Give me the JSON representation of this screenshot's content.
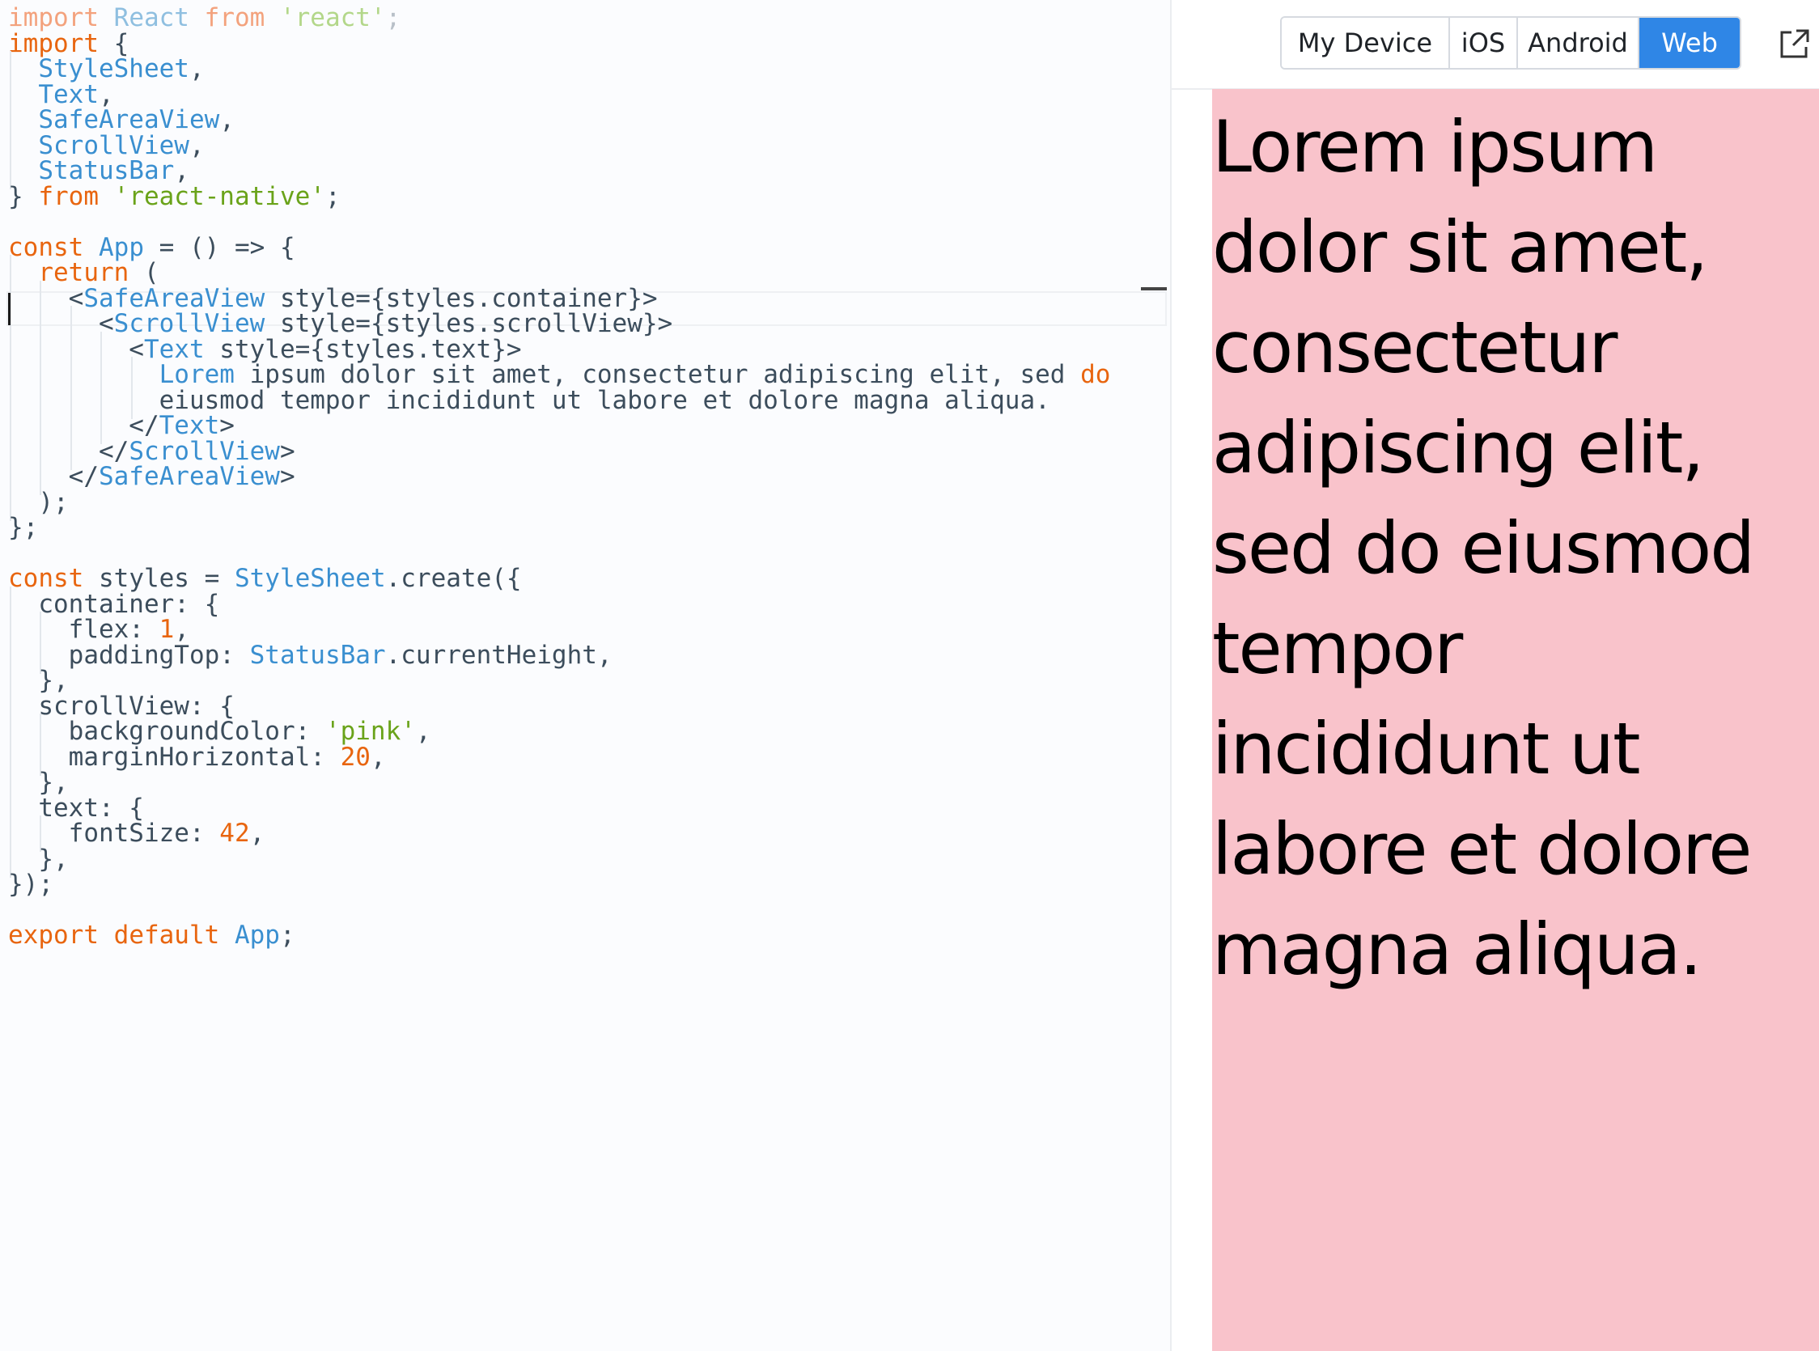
{
  "code_lines": [
    [
      [
        "import",
        "#f3a27d"
      ],
      [
        " ",
        "#3c4d5c"
      ],
      [
        "React",
        "#8fbfe0"
      ],
      [
        " ",
        "#3c4d5c"
      ],
      [
        "from",
        "#f3a27d"
      ],
      [
        " ",
        "#3c4d5c"
      ],
      [
        "'react'",
        "#b3d78a"
      ],
      [
        ";",
        "#b8c0c8"
      ]
    ],
    [
      [
        "import",
        "#e8650f"
      ],
      [
        " {",
        "#3c4d5c"
      ]
    ],
    [
      [
        "  ",
        "#3c4d5c"
      ],
      [
        "StyleSheet",
        "#3a8fd0"
      ],
      [
        ",",
        "#3c4d5c"
      ]
    ],
    [
      [
        "  ",
        "#3c4d5c"
      ],
      [
        "Text",
        "#3a8fd0"
      ],
      [
        ",",
        "#3c4d5c"
      ]
    ],
    [
      [
        "  ",
        "#3c4d5c"
      ],
      [
        "SafeAreaView",
        "#3a8fd0"
      ],
      [
        ",",
        "#3c4d5c"
      ]
    ],
    [
      [
        "  ",
        "#3c4d5c"
      ],
      [
        "ScrollView",
        "#3a8fd0"
      ],
      [
        ",",
        "#3c4d5c"
      ]
    ],
    [
      [
        "  ",
        "#3c4d5c"
      ],
      [
        "StatusBar",
        "#3a8fd0"
      ],
      [
        ",",
        "#3c4d5c"
      ]
    ],
    [
      [
        "} ",
        "#3c4d5c"
      ],
      [
        "from",
        "#e8650f"
      ],
      [
        " ",
        "#3c4d5c"
      ],
      [
        "'react-native'",
        "#6aa31a"
      ],
      [
        ";",
        "#3c4d5c"
      ]
    ],
    [],
    [
      [
        "const",
        "#e8650f"
      ],
      [
        " ",
        "#3c4d5c"
      ],
      [
        "App",
        "#3a8fd0"
      ],
      [
        " = () => {",
        "#3c4d5c"
      ]
    ],
    [
      [
        "  ",
        "#3c4d5c"
      ],
      [
        "return",
        "#e8650f"
      ],
      [
        " (",
        "#3c4d5c"
      ]
    ],
    [
      [
        "    <",
        "#3c4d5c"
      ],
      [
        "SafeAreaView",
        "#3a8fd0"
      ],
      [
        " style={styles.container}>",
        "#3c4d5c"
      ]
    ],
    [
      [
        "      <",
        "#3c4d5c"
      ],
      [
        "ScrollView",
        "#3a8fd0"
      ],
      [
        " style={styles.scrollView}>",
        "#3c4d5c"
      ]
    ],
    [
      [
        "        <",
        "#3c4d5c"
      ],
      [
        "Text",
        "#3a8fd0"
      ],
      [
        " style={styles.text}>",
        "#3c4d5c"
      ]
    ],
    [
      [
        "          ",
        "#3c4d5c"
      ],
      [
        "Lorem",
        "#3a8fd0"
      ],
      [
        " ipsum dolor sit amet, consectetur adipiscing elit, sed ",
        "#3c4d5c"
      ],
      [
        "do",
        "#e8650f"
      ]
    ],
    [
      [
        "          eiusmod tempor incididunt ut labore et dolore magna aliqua.",
        "#3c4d5c"
      ]
    ],
    [
      [
        "        </",
        "#3c4d5c"
      ],
      [
        "Text",
        "#3a8fd0"
      ],
      [
        ">",
        "#3c4d5c"
      ]
    ],
    [
      [
        "      </",
        "#3c4d5c"
      ],
      [
        "ScrollView",
        "#3a8fd0"
      ],
      [
        ">",
        "#3c4d5c"
      ]
    ],
    [
      [
        "    </",
        "#3c4d5c"
      ],
      [
        "SafeAreaView",
        "#3a8fd0"
      ],
      [
        ">",
        "#3c4d5c"
      ]
    ],
    [
      [
        "  );",
        "#3c4d5c"
      ]
    ],
    [
      [
        "};",
        "#3c4d5c"
      ]
    ],
    [],
    [
      [
        "const",
        "#e8650f"
      ],
      [
        " styles = ",
        "#3c4d5c"
      ],
      [
        "StyleSheet",
        "#3a8fd0"
      ],
      [
        ".create({",
        "#3c4d5c"
      ]
    ],
    [
      [
        "  container: {",
        "#3c4d5c"
      ]
    ],
    [
      [
        "    flex: ",
        "#3c4d5c"
      ],
      [
        "1",
        "#e8650f"
      ],
      [
        ",",
        "#3c4d5c"
      ]
    ],
    [
      [
        "    paddingTop: ",
        "#3c4d5c"
      ],
      [
        "StatusBar",
        "#3a8fd0"
      ],
      [
        ".currentHeight,",
        "#3c4d5c"
      ]
    ],
    [
      [
        "  },",
        "#3c4d5c"
      ]
    ],
    [
      [
        "  scrollView: {",
        "#3c4d5c"
      ]
    ],
    [
      [
        "    backgroundColor: ",
        "#3c4d5c"
      ],
      [
        "'pink'",
        "#6aa31a"
      ],
      [
        ",",
        "#3c4d5c"
      ]
    ],
    [
      [
        "    marginHorizontal: ",
        "#3c4d5c"
      ],
      [
        "20",
        "#e8650f"
      ],
      [
        ",",
        "#3c4d5c"
      ]
    ],
    [
      [
        "  },",
        "#3c4d5c"
      ]
    ],
    [
      [
        "  text: {",
        "#3c4d5c"
      ]
    ],
    [
      [
        "    fontSize: ",
        "#3c4d5c"
      ],
      [
        "42",
        "#e8650f"
      ],
      [
        ",",
        "#3c4d5c"
      ]
    ],
    [
      [
        "  },",
        "#3c4d5c"
      ]
    ],
    [
      [
        "});",
        "#3c4d5c"
      ]
    ],
    [],
    [
      [
        "export",
        "#e8650f"
      ],
      [
        " ",
        "#3c4d5c"
      ],
      [
        "default",
        "#e8650f"
      ],
      [
        " ",
        "#3c4d5c"
      ],
      [
        "App",
        "#3a8fd0"
      ],
      [
        ";",
        "#3c4d5c"
      ]
    ]
  ],
  "preview": {
    "tabs": [
      {
        "label": "My Device",
        "active": false
      },
      {
        "label": "iOS",
        "active": false
      },
      {
        "label": "Android",
        "active": false
      },
      {
        "label": "Web",
        "active": true
      }
    ],
    "open_icon": "external-link-icon",
    "text": "Lorem ipsum dolor sit amet, consectetur adipiscing elit, sed do eiusmod tempor incididunt ut labore et dolore magna aliqua.",
    "background_color": "#f9c3cb",
    "accent_color": "#2f86e6"
  }
}
